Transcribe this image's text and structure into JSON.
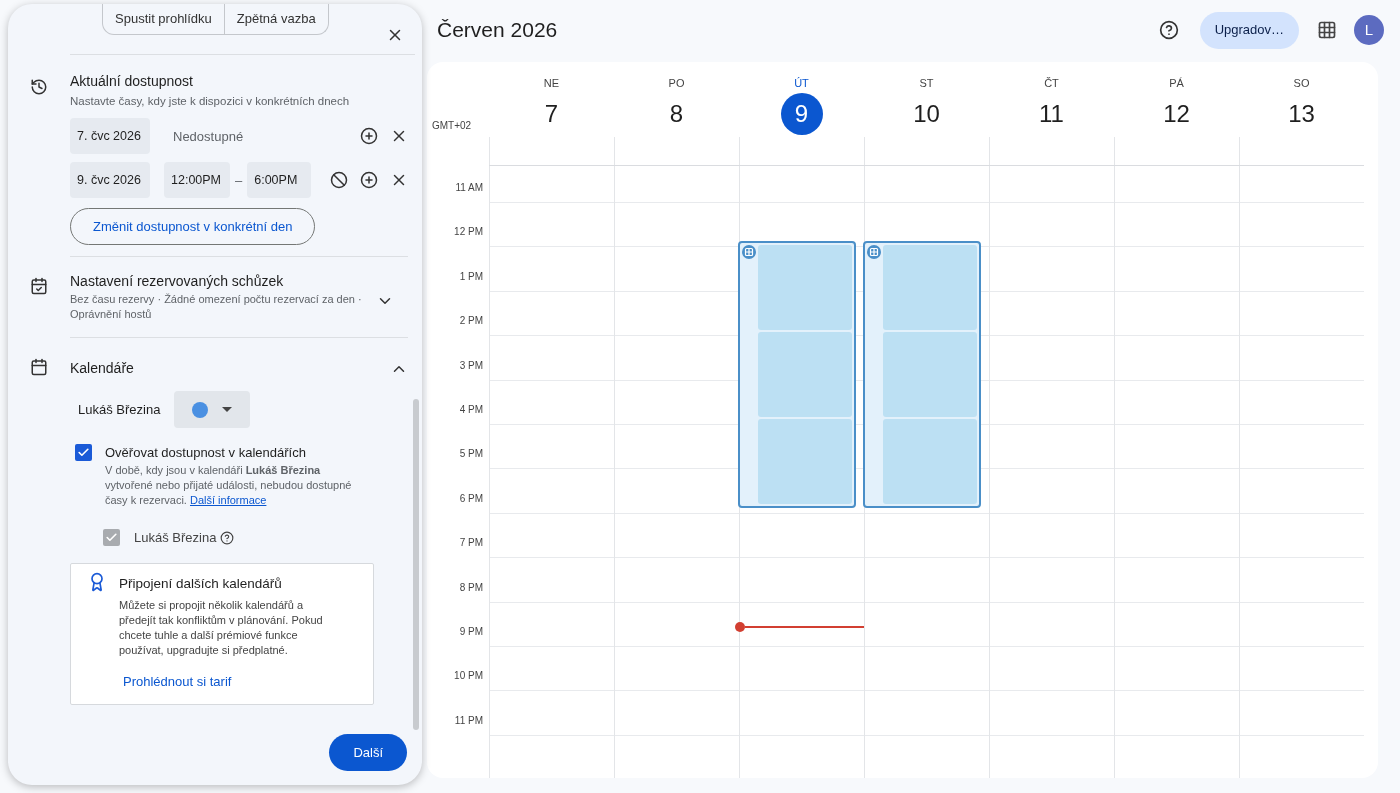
{
  "panel": {
    "top_tabs": [
      {
        "label": "Spustit prohlídku"
      },
      {
        "label": "Zpětná vazba"
      }
    ],
    "availability": {
      "title": "Aktuální dostupnost",
      "subtitle": "Nastavte časy, kdy jste k dispozici v konkrétních dnech",
      "rows": [
        {
          "kind": "unavailable",
          "date": "7. čvc 2026",
          "status": "Nedostupné"
        },
        {
          "kind": "range",
          "date": "9. čvc 2026",
          "start": "12:00PM",
          "separator": "–",
          "end": "6:00PM"
        }
      ],
      "change_button": "Změnit dostupnost v konkrétní den"
    },
    "booking_settings": {
      "title": "Nastavení rezervovaných schůzek",
      "summary": "Bez času rezervy · Žádné omezení počtu rezervací za den · Oprávnění hostů",
      "expanded": false
    },
    "calendars": {
      "title": "Kalendáře",
      "expanded": true,
      "owner": "Lukáš Březina",
      "color": "#4a90e2",
      "check_availability": {
        "label": "Ověřovat dostupnost v kalendářích",
        "checked": true,
        "description": "V době, kdy jsou v kalendáři **Lukáš Březina** vytvořené nebo přijaté události, nebudou dostupné časy k rezervaci.",
        "link": "Další informace"
      },
      "sub_calendars": [
        {
          "label": "Lukáš Březina",
          "checked": true,
          "disabled": true
        }
      ]
    },
    "upsell": {
      "title": "Připojení dalších kalendářů",
      "body": "Můžete si propojit několik kalendářů a předejít tak konfliktům v plánování. Pokud chcete tuhle a další prémiové funkce používat, upgradujte si předplatné.",
      "link": "Prohlédnout si tarif"
    },
    "next_button": "Další"
  },
  "header": {
    "title": "Červen 2026",
    "upgrade_button": "Upgradov…",
    "avatar": "L"
  },
  "calendar": {
    "timezone": "GMT+02",
    "days": [
      {
        "name": "NE",
        "date": "7",
        "selected": false,
        "availability": false
      },
      {
        "name": "PO",
        "date": "8",
        "selected": false,
        "availability": false
      },
      {
        "name": "ÚT",
        "date": "9",
        "selected": true,
        "availability": true
      },
      {
        "name": "ST",
        "date": "10",
        "selected": false,
        "availability": true
      },
      {
        "name": "ČT",
        "date": "11",
        "selected": false,
        "availability": false
      },
      {
        "name": "PÁ",
        "date": "12",
        "selected": false,
        "availability": false
      },
      {
        "name": "SO",
        "date": "13",
        "selected": false,
        "availability": false
      }
    ],
    "hours": [
      "11 AM",
      "12 PM",
      "1 PM",
      "2 PM",
      "3 PM",
      "4 PM",
      "5 PM",
      "6 PM",
      "7 PM",
      "8 PM",
      "9 PM",
      "10 PM",
      "11 PM"
    ]
  }
}
